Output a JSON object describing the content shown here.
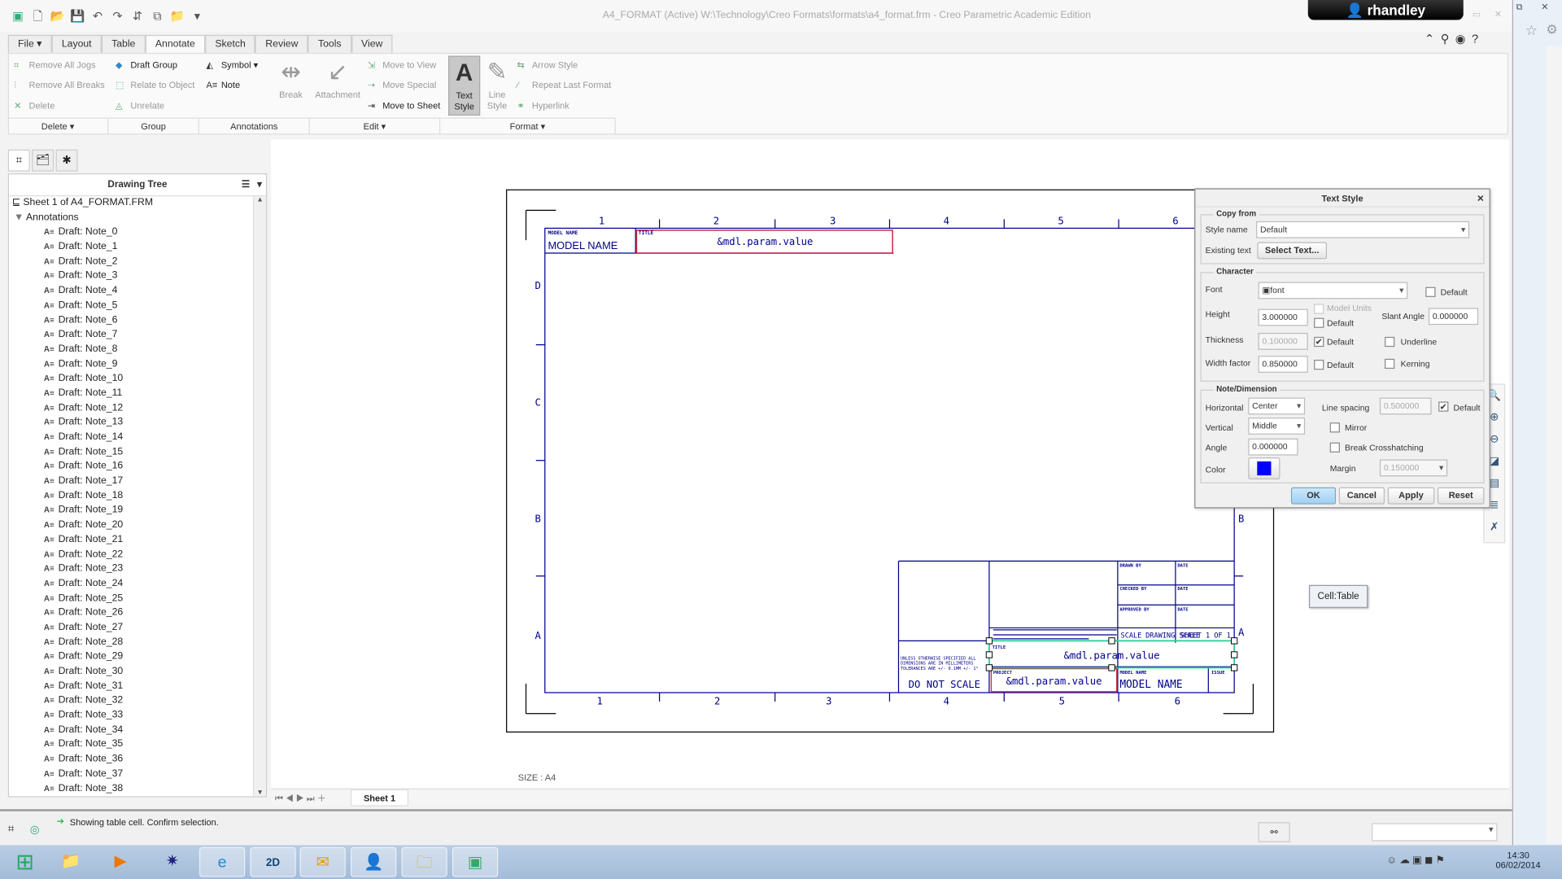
{
  "window": {
    "title": "A4_FORMAT (Active) W:\\Technology\\Creo Formats\\formats\\a4_format.frm - Creo Parametric Academic Edition",
    "user": "rhandley"
  },
  "tabs": [
    "File ▾",
    "Layout",
    "Table",
    "Annotate",
    "Sketch",
    "Review",
    "Tools",
    "View"
  ],
  "active_tab": "Annotate",
  "ribbon": {
    "delete": {
      "remove_all_jogs": "Remove All Jogs",
      "remove_all_breaks": "Remove All Breaks",
      "delete": "Delete",
      "label": "Delete ▾"
    },
    "group": {
      "draft_group": "Draft Group",
      "relate_to_object": "Relate to Object",
      "unrelate": "Unrelate",
      "label": "Group"
    },
    "annotations": {
      "symbol": "Symbol ▾",
      "note": "Note",
      "break": "Break",
      "attachment": "Attachment",
      "label": "Annotations"
    },
    "edit": {
      "move_to_view": "Move to View",
      "move_special": "Move Special",
      "move_to_sheet": "Move to Sheet",
      "label": "Edit ▾"
    },
    "format": {
      "text_style": "Text Style",
      "line_style": "Line Style",
      "arrow_style": "Arrow Style",
      "repeat_last_format": "Repeat Last Format",
      "hyperlink": "Hyperlink",
      "label": "Format ▾"
    }
  },
  "tree": {
    "title": "Drawing Tree",
    "root": "Sheet 1 of A4_FORMAT.FRM",
    "annotations": "Annotations",
    "notes": [
      "Draft: Note_0",
      "Draft: Note_1",
      "Draft: Note_2",
      "Draft: Note_3",
      "Draft: Note_4",
      "Draft: Note_5",
      "Draft: Note_6",
      "Draft: Note_7",
      "Draft: Note_8",
      "Draft: Note_9",
      "Draft: Note_10",
      "Draft: Note_11",
      "Draft: Note_12",
      "Draft: Note_13",
      "Draft: Note_14",
      "Draft: Note_15",
      "Draft: Note_16",
      "Draft: Note_17",
      "Draft: Note_18",
      "Draft: Note_19",
      "Draft: Note_20",
      "Draft: Note_21",
      "Draft: Note_22",
      "Draft: Note_23",
      "Draft: Note_24",
      "Draft: Note_25",
      "Draft: Note_26",
      "Draft: Note_27",
      "Draft: Note_28",
      "Draft: Note_29",
      "Draft: Note_30",
      "Draft: Note_31",
      "Draft: Note_32",
      "Draft: Note_33",
      "Draft: Note_34",
      "Draft: Note_35",
      "Draft: Note_36",
      "Draft: Note_37",
      "Draft: Note_38"
    ]
  },
  "drawing": {
    "col_labels": [
      "1",
      "2",
      "3",
      "4",
      "5",
      "6"
    ],
    "row_labels": [
      "D",
      "C",
      "B",
      "A"
    ],
    "top": {
      "model_name_label": "MODEL NAME",
      "model_name": "MODEL NAME",
      "title_label": "TITLE",
      "title_value": "&mdl.param.value"
    },
    "titleblock": {
      "drawn_by": "DRAWN BY",
      "date": "DATE",
      "checked_by": "CHECKED BY",
      "approved_by": "APPROVED BY",
      "scale": "SCALE",
      "drawing_scale": "DRAWING SCALE",
      "sheet": "SHEET 1 OF 1",
      "title_label": "TITLE",
      "title_value": "&mdl.param.value",
      "project_label": "PROJECT",
      "project_value": "&mdl.param.value",
      "model_name_label": "MODEL NAME",
      "model_name": "MODEL NAME",
      "issue": "ISSUE",
      "tolerance": [
        "UNLESS OTHERWISE SPECIFIED ALL",
        "DIMENSIONS ARE IN MILLIMETERS",
        "TOLERANCES ARE +/- 0.1MM +/- 1°"
      ],
      "do_not_scale": "DO NOT SCALE"
    },
    "size": "SIZE : A4"
  },
  "tooltip": "Cell:Table",
  "sheet_tab": "Sheet 1",
  "status": "Showing table cell. Confirm selection.",
  "dialog": {
    "title": "Text Style",
    "copy_from": "Copy from",
    "style_name_label": "Style name",
    "style_name": "Default",
    "existing_text_label": "Existing text",
    "select_text": "Select Text...",
    "character": "Character",
    "font_label": "Font",
    "font": "font",
    "default": "Default",
    "height_label": "Height",
    "height": "3.000000",
    "model_units": "Model Units",
    "slant_label": "Slant Angle",
    "slant": "0.000000",
    "thickness_label": "Thickness",
    "thickness": "0.100000",
    "underline": "Underline",
    "width_label": "Width factor",
    "width": "0.850000",
    "kerning": "Kerning",
    "note_dim": "Note/Dimension",
    "horizontal_label": "Horizontal",
    "horizontal": "Center",
    "line_spacing_label": "Line spacing",
    "line_spacing": "0.500000",
    "vertical_label": "Vertical",
    "vertical": "Middle",
    "mirror": "Mirror",
    "angle_label": "Angle",
    "angle": "0.000000",
    "break_cross": "Break Crosshatching",
    "color_label": "Color",
    "color": "#0000ff",
    "margin_label": "Margin",
    "margin": "0.150000",
    "ok": "OK",
    "cancel": "Cancel",
    "apply": "Apply",
    "reset": "Reset",
    "checks": {
      "font_default": false,
      "height_default": false,
      "thickness_default": true,
      "width_default": false,
      "underline": false,
      "kerning": false,
      "line_spacing_default": true,
      "mirror": false,
      "break_cross": false
    }
  },
  "clock": {
    "time": "14:30",
    "date": "06/02/2014"
  },
  "colors": {
    "drawing_ink": "#00008b",
    "selection_red": "#cc2244",
    "highlight_green": "#33cc99"
  }
}
